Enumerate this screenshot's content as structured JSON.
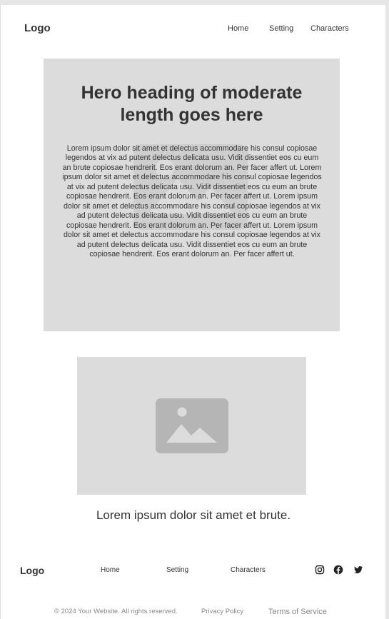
{
  "header": {
    "logo": "Logo",
    "nav": [
      "Home",
      "Setting",
      "Characters"
    ]
  },
  "hero": {
    "heading": "Hero heading of moderate length goes here",
    "body": "Lorem ipsum dolor sit amet et delectus accommodare his consul copiosae legendos at vix ad putent delectus delicata usu. Vidit dissentiet eos cu eum an brute copiosae hendrerit. Eos erant dolorum an. Per facer affert ut. Lorem ipsum dolor sit amet et delectus accommodare his consul copiosae legendos at vix ad putent delectus delicata usu. Vidit dissentiet eos cu eum an brute copiosae hendrerit. Eos erant dolorum an. Per facer affert ut. Lorem ipsum dolor sit amet et delectus accommodare his consul copiosae legendos at vix ad putent delectus delicata usu. Vidit dissentiet eos cu eum an brute copiosae hendrerit. Eos erant dolorum an. Per facer affert ut. Lorem ipsum dolor sit amet et delectus accommodare his consul copiosae legendos at vix ad putent delectus delicata usu. Vidit dissentiet eos cu eum an brute copiosae hendrerit. Eos erant dolorum an. Per facer affert ut.",
    "background_icon": "image-placeholder-icon"
  },
  "media": {
    "icon": "image-placeholder-icon",
    "caption": "Lorem ipsum dolor sit amet et brute."
  },
  "footer": {
    "logo": "Logo",
    "nav": [
      "Home",
      "Setting",
      "Characters"
    ],
    "social": [
      "instagram-icon",
      "facebook-icon",
      "twitter-icon"
    ],
    "copyright": "© 2024 Your Website. All rights reserved.",
    "privacy": "Privacy Policy",
    "terms": "Terms of Service"
  },
  "colors": {
    "placeholder_bg": "#dcdcdc",
    "placeholder_icon": "#b5b5b5",
    "text": "#333333",
    "muted_text": "#888888"
  }
}
